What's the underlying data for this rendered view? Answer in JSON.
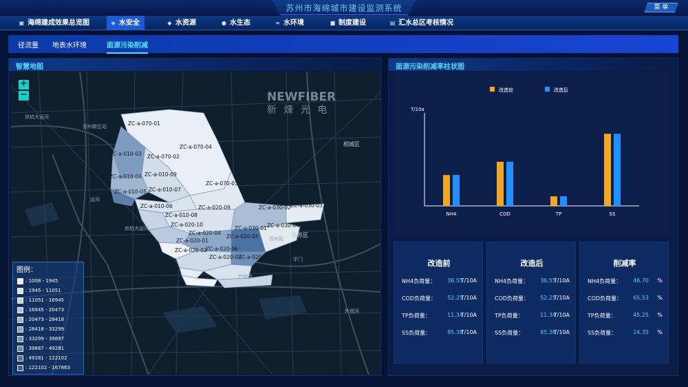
{
  "app_title": "苏州市海绵城市建设监测系统",
  "menu_label": "菜 单",
  "nav": [
    {
      "label": "海绵建成效果总览图",
      "icon": "image-icon"
    },
    {
      "label": "水安全",
      "icon": "shield-icon"
    },
    {
      "label": "水资源",
      "icon": "drop-icon"
    },
    {
      "label": "水生态",
      "icon": "leaf-drop-icon"
    },
    {
      "label": "水环境",
      "icon": "waves-icon"
    },
    {
      "label": "制度建设",
      "icon": "box-icon"
    },
    {
      "label": "汇水总区考核情况",
      "icon": "clipboard-icon"
    }
  ],
  "subnav": [
    "径流量",
    "地表水环境",
    "面源污染削减"
  ],
  "map_panel": {
    "title": "智慧地图",
    "zoom_in": "+",
    "zoom_out": "−",
    "watermark_brand": "NEWFIBER",
    "watermark_cn": "新 烽 光 电",
    "place_labels": [
      "京杭大运河",
      "苏州新区站",
      "苏州站",
      "相城区",
      "姑苏区",
      "平门",
      "外城河",
      "竹辉路",
      "京杭大运河",
      "运河"
    ],
    "zone_labels": [
      "ZC-a-070-01",
      "ZC-a-010-03",
      "ZC-a-070-02",
      "ZC-a-070-04",
      "ZC-a-010-09",
      "ZC-a-010-04",
      "ZC-a-010-07",
      "ZC-a-010-05",
      "ZC-a-070-03",
      "ZC-a-010-06",
      "ZC-a-020-09",
      "ZC-a-030-02",
      "ZC-a-030-03",
      "ZC-a-010-08",
      "ZC-a-020-10",
      "ZC-a-030-01",
      "ZC-a-030-04",
      "ZC-a-020-04",
      "ZC-a-020-05",
      "ZC-a-020-01",
      "ZC-a-020-06",
      "ZC-a-020-02",
      "ZC-a-020-03",
      "ZC-a-020-07"
    ],
    "legend": {
      "title": "图例：",
      "items": [
        {
          "label": ": 1008 - 1945",
          "color": "#e8eef5"
        },
        {
          "label": ": 1945 - 11051",
          "color": "#d6e1ec"
        },
        {
          "label": ": 11051 - 16945",
          "color": "#c2d2e3"
        },
        {
          "label": ": 16945 - 20473",
          "color": "#aec3d9"
        },
        {
          "label": ": 20473 - 28418",
          "color": "#9ab3cf"
        },
        {
          "label": ": 28418 - 33299",
          "color": "#86a3c4"
        },
        {
          "label": ": 33299 - 39887",
          "color": "#7293ba"
        },
        {
          "label": ": 39887 - 49281",
          "color": "#5e84b0"
        },
        {
          "label": ": 49281 - 122102",
          "color": "#4a75a7"
        },
        {
          "label": ": 122102 - 167863",
          "color": "#36669d"
        }
      ]
    }
  },
  "chart_panel": {
    "title": "面源污染削减率柱状图"
  },
  "chart_data": {
    "type": "bar",
    "categories": [
      "NH4",
      "COD",
      "TP",
      "SS"
    ],
    "series": [
      {
        "name": "改造前",
        "values": [
          36.55,
          52.25,
          11.34,
          85.36
        ],
        "color": "#f5a623"
      },
      {
        "name": "改造后",
        "values": [
          36.55,
          52.25,
          11.34,
          85.36
        ],
        "color": "#1e90ff"
      }
    ],
    "ylabel": "T/10a",
    "legend": "top-center",
    "grid": false
  },
  "cards": [
    {
      "title": "改造前",
      "rows": [
        {
          "label": "NH4负荷量：",
          "value": "36.55",
          "unit": "T/10A"
        },
        {
          "label": "COD负荷量：",
          "value": "52.25",
          "unit": "T/10A"
        },
        {
          "label": "TP负荷量：",
          "value": "11.34",
          "unit": "T/10A"
        },
        {
          "label": "SS负荷量：",
          "value": "85.36",
          "unit": "T/10A"
        }
      ]
    },
    {
      "title": "改造后",
      "rows": [
        {
          "label": "NH4负荷量：",
          "value": "36.55",
          "unit": "T/10A"
        },
        {
          "label": "COD负荷量：",
          "value": "52.25",
          "unit": "T/10A"
        },
        {
          "label": "TP负荷量：",
          "value": "11.34",
          "unit": "T/10A"
        },
        {
          "label": "SS负荷量：",
          "value": "85.36",
          "unit": "T/10A"
        }
      ]
    },
    {
      "title": "削减率",
      "rows": [
        {
          "label": "NH4负荷量：",
          "value": "46.70",
          "unit": "%"
        },
        {
          "label": "COD负荷量：",
          "value": "65.53",
          "unit": "%"
        },
        {
          "label": "TP负荷量：",
          "value": "45.25",
          "unit": "%"
        },
        {
          "label": "SS负荷量：",
          "value": "24.35",
          "unit": "%"
        }
      ]
    }
  ]
}
